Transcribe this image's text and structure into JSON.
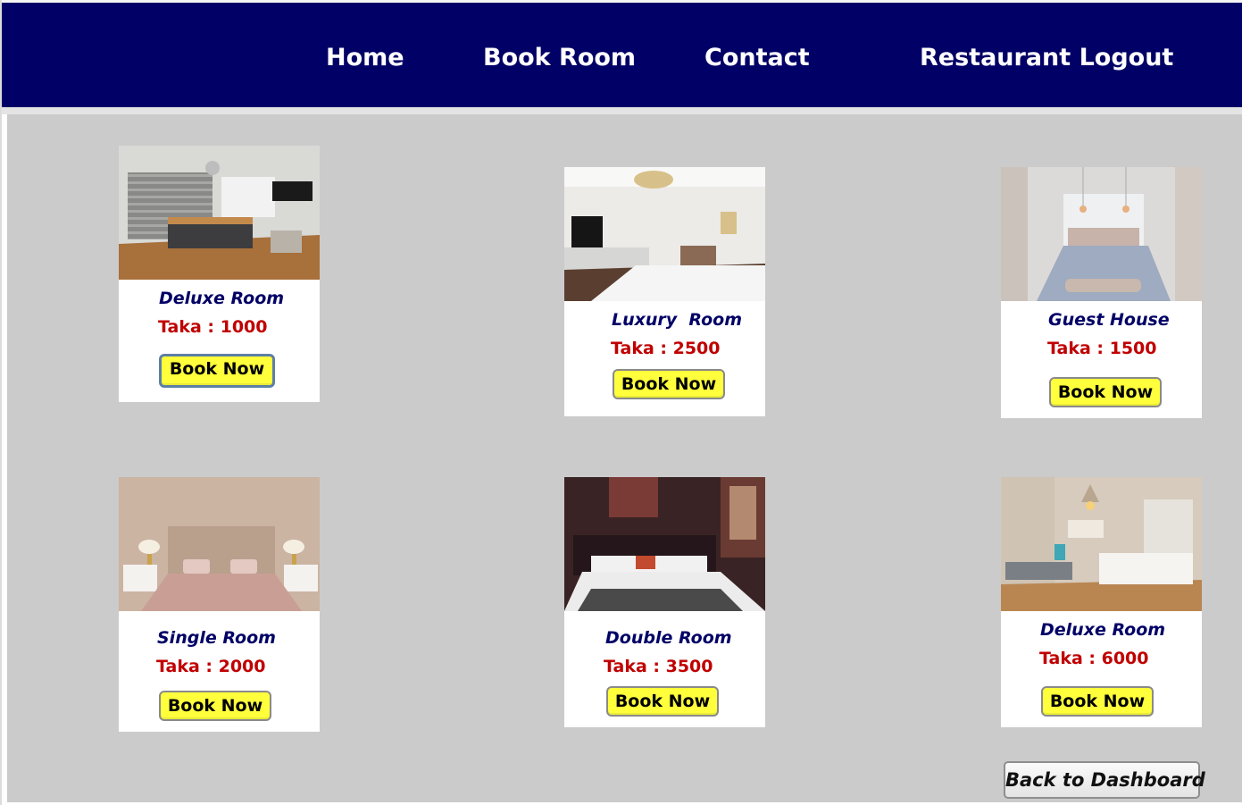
{
  "nav": {
    "home": "Home",
    "book_room": "Book Room",
    "contact": "Contact",
    "restaurant_logout": "Restaurant Logout"
  },
  "rooms": [
    {
      "name": "Deluxe Room",
      "price": "Taka : 1000",
      "button": "Book Now"
    },
    {
      "name": "Luxury  Room",
      "price": "Taka : 2500",
      "button": "Book Now"
    },
    {
      "name": "Guest House",
      "price": "Taka : 1500",
      "button": "Book Now"
    },
    {
      "name": "Single Room",
      "price": "Taka : 2000",
      "button": "Book Now"
    },
    {
      "name": "Double Room",
      "price": "Taka : 3500",
      "button": "Book Now"
    },
    {
      "name": "Deluxe Room",
      "price": "Taka : 6000",
      "button": "Book Now"
    }
  ],
  "back_button": "Back to Dashboard",
  "colors": {
    "navbar": "#010066",
    "room_name": "#010066",
    "price": "#c00000",
    "button": "#ffff3c",
    "content_bg": "#cbcbcb"
  }
}
